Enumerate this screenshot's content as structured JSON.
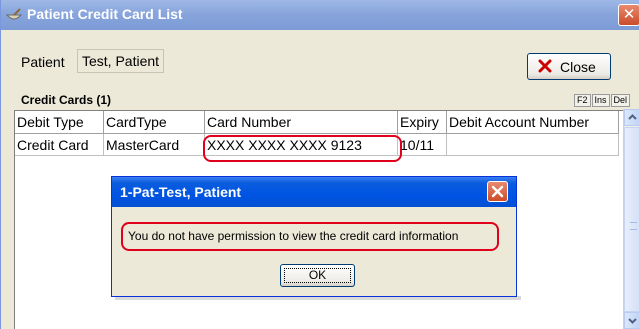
{
  "window": {
    "title": "Patient Credit Card List",
    "close_glyph": "✕",
    "app_icon": "mortar-pestle-icon"
  },
  "patient": {
    "label": "Patient",
    "name": "Test, Patient"
  },
  "close_button": {
    "label": "Close",
    "icon": "x-icon"
  },
  "cards_section": {
    "header": "Credit Cards (1)",
    "hotkeys": [
      "F2",
      "Ins",
      "Del"
    ]
  },
  "table": {
    "columns": [
      "Debit Type",
      "CardType",
      "Card Number",
      "Expiry",
      "Debit Account Number"
    ],
    "rows": [
      [
        "Credit Card",
        "MasterCard",
        "XXXX XXXX XXXX 9123",
        "10/11",
        ""
      ]
    ]
  },
  "dialog": {
    "title": "1-Pat-Test, Patient",
    "message": "You do not have permission to view the credit card information",
    "ok_label": "OK"
  },
  "colors": {
    "highlight_outline": "#e0001b",
    "dialog_titlebar": "#0054e3",
    "main_titlebar": "#88a5dc"
  }
}
